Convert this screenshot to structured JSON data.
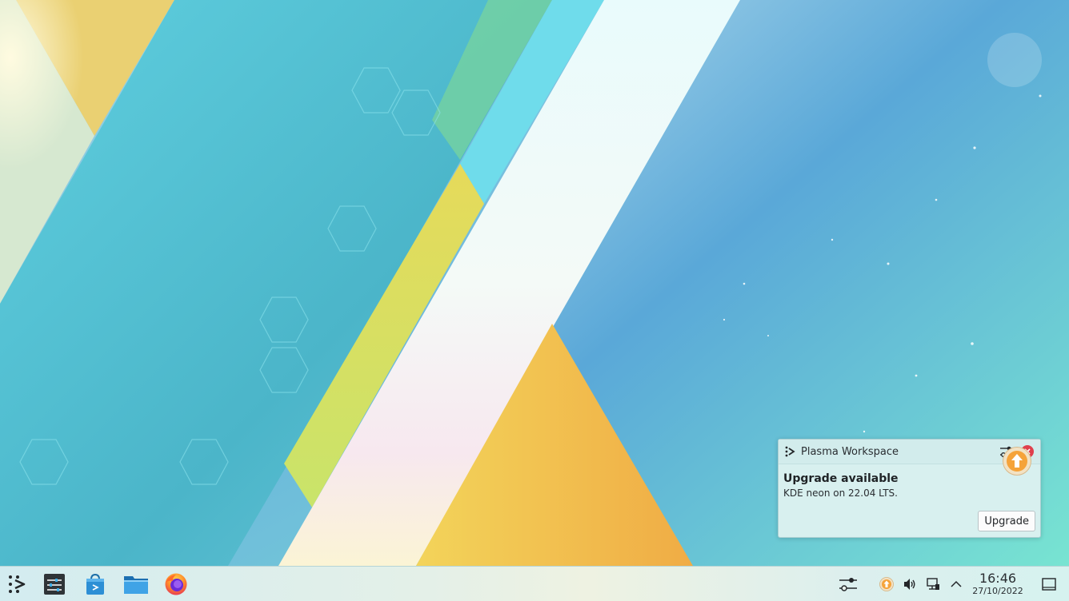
{
  "notification": {
    "app_name": "Plasma Workspace",
    "title": "Upgrade available",
    "body": "KDE neon on 22.04 LTS.",
    "action_label": "Upgrade"
  },
  "taskbar": {
    "apps": [
      {
        "name": "Application Launcher",
        "icon": "kde-launcher-icon"
      },
      {
        "name": "System Settings",
        "icon": "settings-panel-icon"
      },
      {
        "name": "Discover",
        "icon": "discover-bag-icon"
      },
      {
        "name": "Dolphin",
        "icon": "folder-icon"
      },
      {
        "name": "Firefox",
        "icon": "firefox-icon"
      }
    ],
    "tray": [
      "sliders-icon",
      "update-icon",
      "volume-icon",
      "network-icon",
      "chevron-up-icon"
    ],
    "clock": {
      "time": "16:46",
      "date": "27/10/2022"
    }
  },
  "colors": {
    "accent": "#3daee9",
    "close": "#e0404d",
    "update_orange": "#f08c1e"
  }
}
